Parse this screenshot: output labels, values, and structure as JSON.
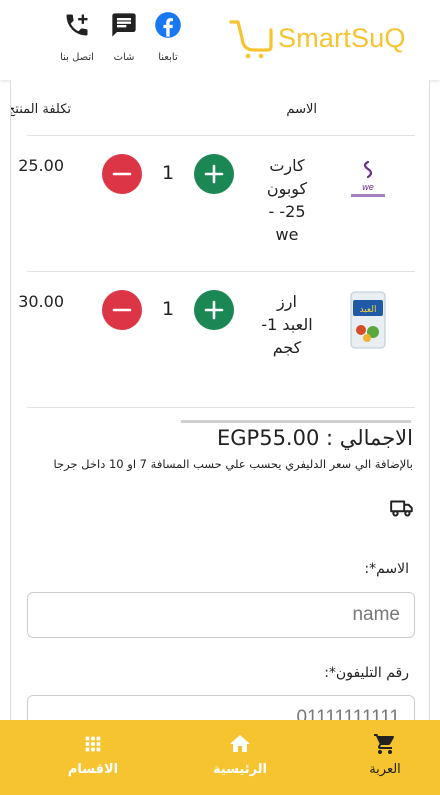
{
  "header": {
    "brand": "SmartSuQ",
    "actions": [
      {
        "label": "تابعنا",
        "icon": "facebook-icon"
      },
      {
        "label": "شات",
        "icon": "chat-icon"
      },
      {
        "label": "اتصل بنا",
        "icon": "add-call-icon"
      }
    ]
  },
  "cart": {
    "columns": {
      "name": "الاسم",
      "cost": "تكلفة المنتج"
    },
    "items": [
      {
        "name": "كارت كوبون 25- - we",
        "quantity": "1",
        "price": "25.00",
        "image": "we-card-image"
      },
      {
        "name": "ارز العبد 1- كجم",
        "quantity": "1",
        "price": "30.00",
        "image": "rice-bag-image"
      }
    ],
    "total": "الاجمالي : EGP55.00",
    "delivery_note": "بالإضافة الي سعر الدليفري يحسب علي حسب المسافة 7 او 10 داخل جرجا"
  },
  "form": {
    "name_label": "الاسم*:",
    "name_placeholder": "name",
    "phone_label": "رقم التليفون*:",
    "phone_placeholder": "01111111111"
  },
  "bottom_nav": [
    {
      "label": "العربة",
      "icon": "cart-icon",
      "active": true
    },
    {
      "label": "الرئيسية",
      "icon": "home-icon",
      "active": false
    },
    {
      "label": "الاقسام",
      "icon": "grid-icon",
      "active": false
    }
  ],
  "colors": {
    "brand_yellow": "#f6c431",
    "plus_green": "#1a8754",
    "minus_red": "#dc3545",
    "facebook_blue": "#1877f2"
  }
}
